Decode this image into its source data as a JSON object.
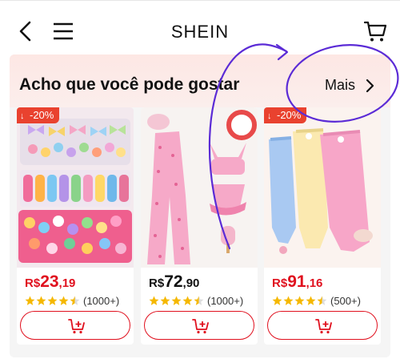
{
  "header": {
    "brand": "SHEIN",
    "back_icon": "chevron-left-icon",
    "menu_icon": "hamburger-menu-icon",
    "cart_icon": "cart-icon"
  },
  "section": {
    "title": "Acho que você pode gostar",
    "more_label": "Mais",
    "more_icon": "chevron-right-icon"
  },
  "products": [
    {
      "badge": "-20%",
      "currency": "R$",
      "price_int": "23",
      "price_dec": ",19",
      "rating": 4.5,
      "reviews": "(1000+)",
      "discounted": true
    },
    {
      "badge": "",
      "currency": "R$",
      "price_int": "72",
      "price_dec": ",90",
      "rating": 4.5,
      "reviews": "(1000+)",
      "discounted": false
    },
    {
      "badge": "-20%",
      "currency": "R$",
      "price_int": "91",
      "price_dec": ",16",
      "rating": 4.5,
      "reviews": "(500+)",
      "discounted": true
    }
  ],
  "colors": {
    "accent_red": "#e0101e",
    "badge_red": "#e9422f",
    "annotation_purple": "#5b2bd6",
    "star_yellow": "#f5b800"
  }
}
